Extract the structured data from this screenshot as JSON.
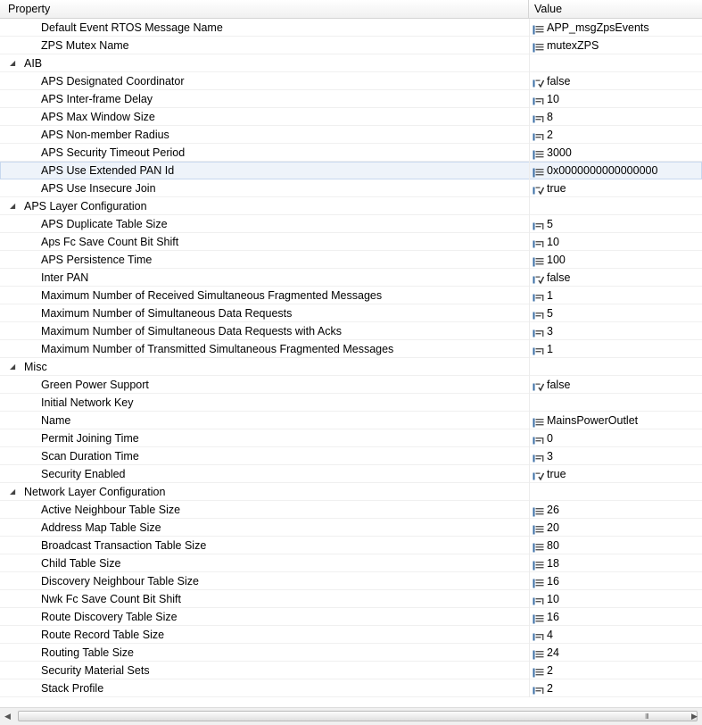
{
  "header": {
    "property": "Property",
    "value": "Value"
  },
  "rows": [
    {
      "name": "Default Event RTOS Message Name",
      "value": "APP_msgZpsEvents",
      "icon": "text"
    },
    {
      "name": "ZPS Mutex Name",
      "value": "mutexZPS",
      "icon": "text"
    },
    {
      "name": "AIB",
      "group": true
    },
    {
      "name": "APS Designated Coordinator",
      "value": "false",
      "icon": "bool"
    },
    {
      "name": "APS Inter-frame Delay",
      "value": "10",
      "icon": "int"
    },
    {
      "name": "APS Max Window Size",
      "value": "8",
      "icon": "int"
    },
    {
      "name": "APS Non-member Radius",
      "value": "2",
      "icon": "int"
    },
    {
      "name": "APS Security Timeout Period",
      "value": "3000",
      "icon": "text"
    },
    {
      "name": "APS Use Extended PAN Id",
      "value": "0x0000000000000000",
      "icon": "text",
      "selected": true
    },
    {
      "name": "APS Use Insecure Join",
      "value": "true",
      "icon": "bool"
    },
    {
      "name": "APS Layer Configuration",
      "group": true
    },
    {
      "name": "APS Duplicate Table Size",
      "value": "5",
      "icon": "int"
    },
    {
      "name": "Aps Fc Save Count Bit Shift",
      "value": "10",
      "icon": "int"
    },
    {
      "name": "APS Persistence Time",
      "value": "100",
      "icon": "text"
    },
    {
      "name": "Inter PAN",
      "value": "false",
      "icon": "bool"
    },
    {
      "name": "Maximum Number of Received Simultaneous Fragmented Messages",
      "value": "1",
      "icon": "int"
    },
    {
      "name": "Maximum Number of Simultaneous Data Requests",
      "value": "5",
      "icon": "int"
    },
    {
      "name": "Maximum Number of Simultaneous Data Requests with Acks",
      "value": "3",
      "icon": "int"
    },
    {
      "name": "Maximum Number of Transmitted Simultaneous Fragmented Messages",
      "value": "1",
      "icon": "int"
    },
    {
      "name": "Misc",
      "group": true
    },
    {
      "name": "Green Power Support",
      "value": "false",
      "icon": "bool"
    },
    {
      "name": "Initial Network Key",
      "value": "",
      "icon": ""
    },
    {
      "name": "Name",
      "value": "MainsPowerOutlet",
      "icon": "text"
    },
    {
      "name": "Permit Joining Time",
      "value": "0",
      "icon": "int"
    },
    {
      "name": "Scan Duration Time",
      "value": "3",
      "icon": "int"
    },
    {
      "name": "Security Enabled",
      "value": "true",
      "icon": "bool"
    },
    {
      "name": "Network Layer Configuration",
      "group": true
    },
    {
      "name": "Active Neighbour Table Size",
      "value": "26",
      "icon": "text"
    },
    {
      "name": "Address Map Table Size",
      "value": "20",
      "icon": "text"
    },
    {
      "name": "Broadcast Transaction Table Size",
      "value": "80",
      "icon": "text"
    },
    {
      "name": "Child Table Size",
      "value": "18",
      "icon": "text"
    },
    {
      "name": "Discovery Neighbour Table Size",
      "value": "16",
      "icon": "text"
    },
    {
      "name": "Nwk Fc Save Count Bit Shift",
      "value": "10",
      "icon": "int"
    },
    {
      "name": "Route Discovery Table Size",
      "value": "16",
      "icon": "text"
    },
    {
      "name": "Route Record Table Size",
      "value": "4",
      "icon": "int"
    },
    {
      "name": "Routing Table Size",
      "value": "24",
      "icon": "text"
    },
    {
      "name": "Security Material Sets",
      "value": "2",
      "icon": "text"
    },
    {
      "name": "Stack Profile",
      "value": "2",
      "icon": "int"
    }
  ],
  "scrollbar": {
    "grip": "III"
  },
  "colors": {
    "selected_row": "#eef3fa",
    "icon_blue": "#3a6ea5"
  }
}
